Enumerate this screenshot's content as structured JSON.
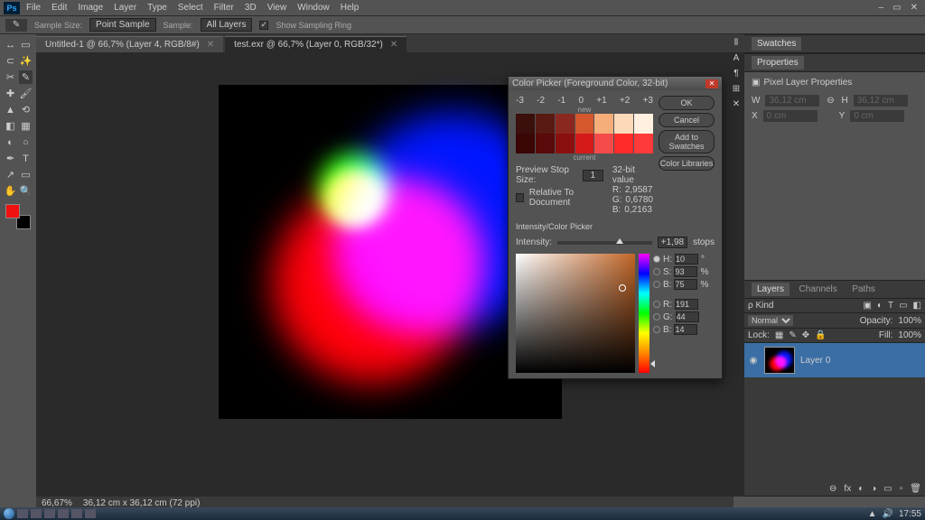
{
  "menubar": {
    "items": [
      "File",
      "Edit",
      "Image",
      "Layer",
      "Type",
      "Select",
      "Filter",
      "3D",
      "View",
      "Window",
      "Help"
    ]
  },
  "optbar": {
    "sample_size_label": "Sample Size:",
    "sample_size_value": "Point Sample",
    "sample_label": "Sample:",
    "sample_value": "All Layers",
    "show_sampling": "Show Sampling Ring"
  },
  "tabs": [
    {
      "label": "Untitled-1 @ 66,7% (Layer 4, RGB/8#)",
      "active": false
    },
    {
      "label": "test.exr @ 66,7% (Layer 0, RGB/32*)",
      "active": true
    }
  ],
  "tools": [
    [
      "↔",
      "▭"
    ],
    [
      "⊡",
      "✎"
    ],
    [
      "⊹",
      "✂"
    ],
    [
      "✓",
      "✎"
    ],
    [
      "◉",
      "✚"
    ],
    [
      "≡",
      "◧"
    ],
    [
      "△",
      "✎"
    ],
    [
      "◐",
      "T"
    ],
    [
      "✦",
      "⬚"
    ],
    [
      "✋",
      "🔍"
    ]
  ],
  "swatches_panel": "Swatches",
  "properties_panel": "Properties",
  "props_title": "Pixel Layer Properties",
  "props": {
    "w": "36,12 cm",
    "h": "36,12 cm",
    "x": "0 cm",
    "y": "0 cm"
  },
  "layers": {
    "tabs": [
      "Layers",
      "Channels",
      "Paths"
    ],
    "kind_label": "ρ Kind",
    "mode": "Normal",
    "opacity_label": "Opacity:",
    "opacity": "100%",
    "lock_label": "Lock:",
    "fill_label": "Fill:",
    "fill": "100%",
    "layer_name": "Layer 0"
  },
  "status": {
    "zoom": "66,67%",
    "doc": "36,12 cm x 36,12 cm (72 ppi)"
  },
  "taskbar": {
    "time": "17:55"
  },
  "picker": {
    "title": "Color Picker (Foreground Color, 32-bit)",
    "stops_top_label": "new",
    "stops_bottom_label": "current",
    "stop_indices": [
      "-3",
      "-2",
      "-1",
      "0",
      "+1",
      "+2",
      "+3"
    ],
    "stop_top_colors": [
      "#3a0f0c",
      "#5a1a14",
      "#8a281f",
      "#d4572e",
      "#f5ad7a",
      "#fcd9b8",
      "#fff0e0"
    ],
    "stop_bottom_colors": [
      "#3a0606",
      "#5a0a0a",
      "#8a1010",
      "#d41a1a",
      "#f54a4a",
      "#ff2a2a",
      "#ff3a3a"
    ],
    "preview_stop_label": "Preview Stop Size:",
    "preview_stop_value": "1",
    "relative_label": "Relative To Document",
    "val32_label": "32-bit value",
    "val32": {
      "R": "2,9587",
      "G": "0,6780",
      "B": "0,2163"
    },
    "section": "Intensity/Color Picker",
    "intensity_label": "Intensity:",
    "intensity_value": "+1,98",
    "intensity_unit": "stops",
    "btns": {
      "ok": "OK",
      "cancel": "Cancel",
      "add": "Add to Swatches",
      "lib": "Color Libraries"
    },
    "hsb": {
      "H": "10",
      "S": "93",
      "B": "75"
    },
    "rgb": {
      "R": "191",
      "G": "44",
      "B": "14"
    }
  }
}
